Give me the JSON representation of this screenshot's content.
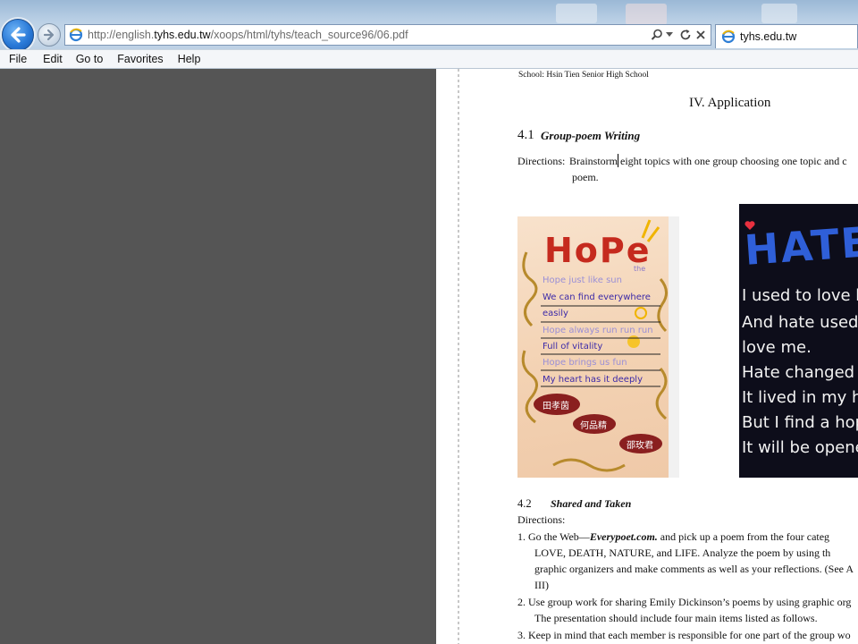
{
  "browser": {
    "address_url_prefix": "http://english.",
    "address_url_domain": "tyhs.edu.tw",
    "address_url_suffix": "/xoops/html/tyhs/teach_source96/06.pdf",
    "tab_title": "tyhs.edu.tw",
    "icons": {
      "back": "arrow-left-icon",
      "forward": "arrow-right-icon",
      "search": "search-icon",
      "dropdown": "chevron-down-icon",
      "refresh": "refresh-icon",
      "stop": "close-icon",
      "page": "ie-page-icon"
    }
  },
  "menubar": {
    "items": [
      "File",
      "Edit",
      "Go to",
      "Favorites",
      "Help"
    ]
  },
  "document": {
    "school_line": "School: Hsin Tien Senior High School",
    "section_heading": "IV. Application",
    "sub41": {
      "number": "4.1",
      "title": "Group-poem Writing",
      "directions_label": "Directions:",
      "directions_text": "Brainstorm eight topics with one group choosing one topic and c",
      "directions_cont": "poem."
    },
    "hope_image": {
      "title": "HoPe",
      "tag": "the",
      "lines": [
        "Hope just like sun",
        "We can find everywhere",
        "easily",
        "Hope always run run run",
        "Full of vitality",
        "Hope brings us fun",
        "My heart has it deeply"
      ],
      "names": [
        "田孝茵",
        "何品精",
        "邵玫君"
      ]
    },
    "hate_image": {
      "title": "HATE",
      "lines": [
        "I used to love ho",
        "And hate used to",
        "love me.",
        "Hate changed my",
        "It lived in my heart",
        "But I find a hope a",
        "It will be opened by"
      ]
    },
    "sub42": {
      "number": "4.2",
      "title": "Shared and Taken",
      "directions_label": "Directions:",
      "item1_lines": [
        "1. Go the Web—",
        "Everypoet.com.",
        " and pick up a poem from the four categ",
        "LOVE, DEATH, NATURE, and LIFE. Analyze the poem by using th",
        "graphic organizers and make comments as well as your reflections. (See A",
        "III)"
      ],
      "item2_lines": [
        "2. Use group work for sharing Emily Dickinson’s poems by using graphic org",
        "The presentation should include four main items listed as follows."
      ],
      "item3_line": "3. Keep in mind that each member is responsible for one part of the group wo"
    }
  }
}
